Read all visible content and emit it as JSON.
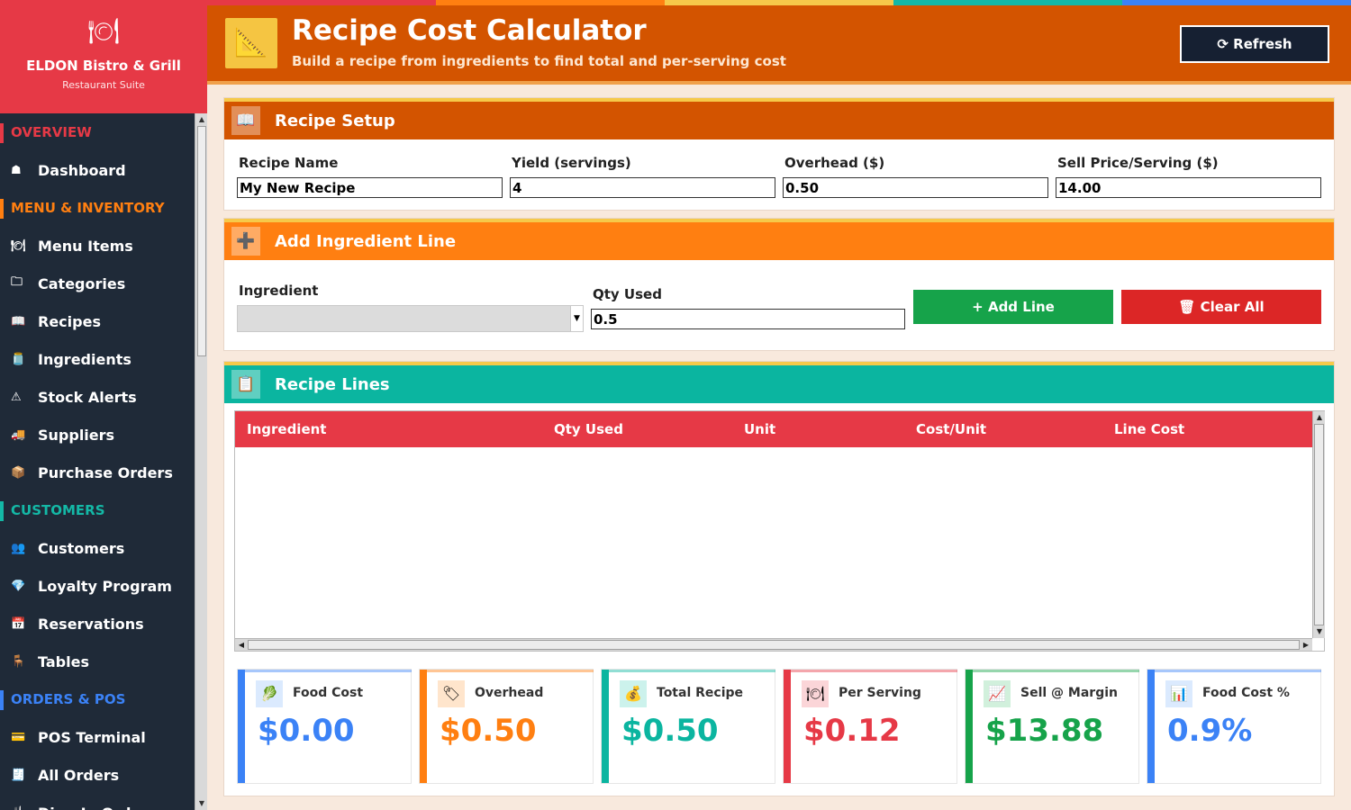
{
  "brand": {
    "icon": "fork-plate-knife-icon",
    "name": "ELDON Bistro & Grill",
    "subtitle": "Restaurant Suite"
  },
  "sidebar": {
    "sections": [
      {
        "title": "OVERVIEW",
        "color": "#e63946",
        "items": [
          {
            "label": "Dashboard",
            "icon": "home-icon",
            "glyph": "☗"
          }
        ]
      },
      {
        "title": "MENU & INVENTORY",
        "color": "#ff7f11",
        "items": [
          {
            "label": "Menu Items",
            "icon": "cutlery-icon",
            "glyph": "🍽"
          },
          {
            "label": "Categories",
            "icon": "folder-icon",
            "glyph": "🗀"
          },
          {
            "label": "Recipes",
            "icon": "book-icon",
            "glyph": "📖"
          },
          {
            "label": "Ingredients",
            "icon": "jar-icon",
            "glyph": "🫙"
          },
          {
            "label": "Stock Alerts",
            "icon": "warning-icon",
            "glyph": "⚠"
          },
          {
            "label": "Suppliers",
            "icon": "truck-icon",
            "glyph": "🚚"
          },
          {
            "label": "Purchase Orders",
            "icon": "box-icon",
            "glyph": "📦"
          }
        ]
      },
      {
        "title": "CUSTOMERS",
        "color": "#14b8a6",
        "items": [
          {
            "label": "Customers",
            "icon": "users-icon",
            "glyph": "👥"
          },
          {
            "label": "Loyalty Program",
            "icon": "diamond-icon",
            "glyph": "💎"
          },
          {
            "label": "Reservations",
            "icon": "calendar-icon",
            "glyph": "📅"
          },
          {
            "label": "Tables",
            "icon": "chair-icon",
            "glyph": "🪑"
          }
        ]
      },
      {
        "title": "ORDERS & POS",
        "color": "#3b82f6",
        "items": [
          {
            "label": "POS Terminal",
            "icon": "credit-card-icon",
            "glyph": "💳"
          },
          {
            "label": "All Orders",
            "icon": "receipt-icon",
            "glyph": "🧾"
          },
          {
            "label": "Dine-In Orders",
            "icon": "fork-knife-icon",
            "glyph": "🍴"
          }
        ]
      }
    ]
  },
  "header": {
    "icon": "ruler-icon",
    "title": "Recipe Cost Calculator",
    "subtitle": "Build a recipe from ingredients to find total and per-serving cost",
    "refresh_label": "⟳ Refresh",
    "stripe_colors": [
      "#e63946",
      "#ff7f11",
      "#f6c94a",
      "#14b8a6",
      "#3b82f6"
    ]
  },
  "recipe_setup": {
    "title": "Recipe Setup",
    "color": "#d35400",
    "fields": [
      {
        "label": "Recipe Name",
        "value": "My New Recipe"
      },
      {
        "label": "Yield (servings)",
        "value": "4"
      },
      {
        "label": "Overhead ($)",
        "value": "0.50"
      },
      {
        "label": "Sell Price/Serving ($)",
        "value": "14.00"
      }
    ]
  },
  "add_line": {
    "title": "Add Ingredient Line",
    "color": "#ff7f11",
    "ingredient_label": "Ingredient",
    "ingredient_value": "",
    "qty_label": "Qty Used",
    "qty_value": "0.5",
    "add_button": "+ Add Line",
    "clear_button": "🗑 Clear All",
    "add_color": "#16a34a",
    "clear_color": "#dc2626"
  },
  "recipe_lines": {
    "title": "Recipe Lines",
    "color": "#0bb5a0",
    "header_color": "#e63946",
    "columns": [
      "Ingredient",
      "Qty Used",
      "Unit",
      "Cost/Unit",
      "Line Cost"
    ],
    "rows": []
  },
  "stats": [
    {
      "label": "Food Cost",
      "value": "$0.00",
      "icon": "lettuce-icon",
      "glyph": "🥬",
      "color": "#3b82f6",
      "bg": "#dbeafe"
    },
    {
      "label": "Overhead",
      "value": "$0.50",
      "icon": "tag-icon",
      "glyph": "🏷",
      "color": "#ff7f11",
      "bg": "#ffe5cc"
    },
    {
      "label": "Total Recipe",
      "value": "$0.50",
      "icon": "money-bag-icon",
      "glyph": "💰",
      "color": "#0bb5a0",
      "bg": "#ccf2ec"
    },
    {
      "label": "Per Serving",
      "value": "$0.12",
      "icon": "plate-icon",
      "glyph": "🍽",
      "color": "#e63946",
      "bg": "#fbd5d8"
    },
    {
      "label": "Sell @ Margin",
      "value": "$13.88",
      "icon": "trend-up-icon",
      "glyph": "📈",
      "color": "#16a34a",
      "bg": "#d1f0dc"
    },
    {
      "label": "Food Cost %",
      "value": "0.9%",
      "icon": "bar-chart-icon",
      "glyph": "📊",
      "color": "#3b82f6",
      "bg": "#dbeafe"
    }
  ]
}
